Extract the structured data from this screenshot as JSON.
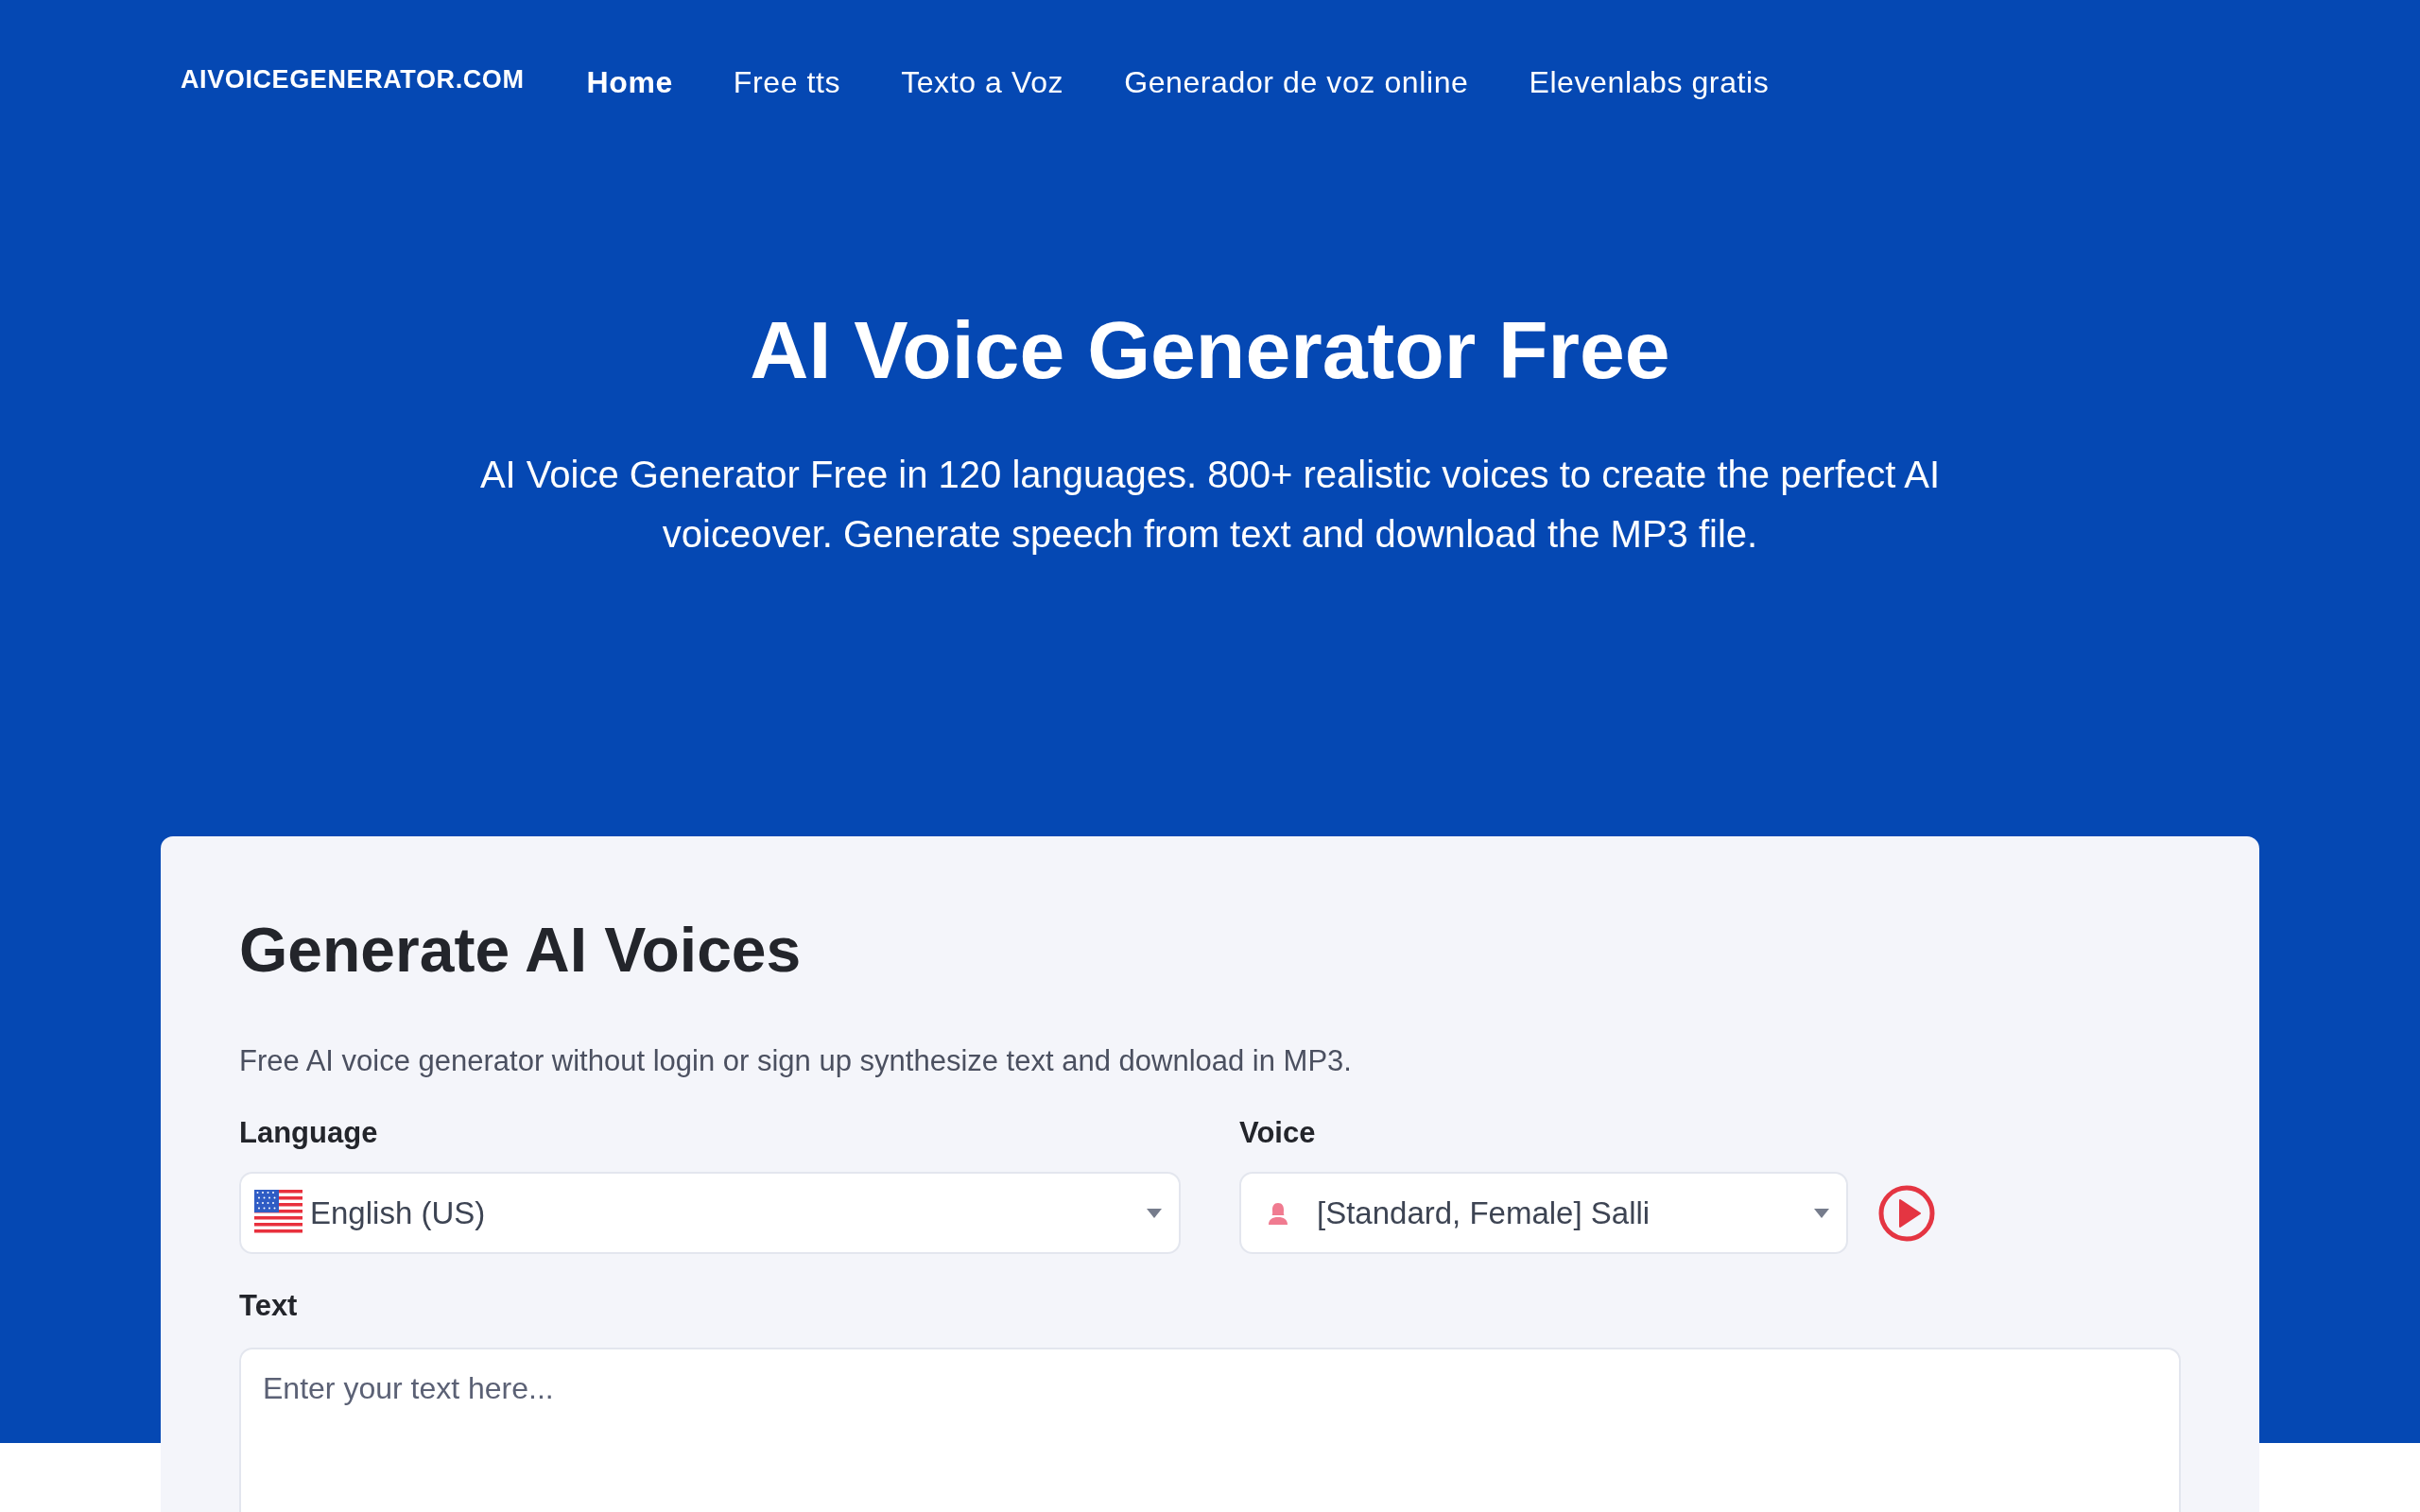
{
  "header": {
    "logo": "AIVOICEGENERATOR.COM",
    "nav": [
      {
        "label": "Home",
        "selected": true
      },
      {
        "label": "Free tts",
        "selected": false
      },
      {
        "label": "Texto a Voz",
        "selected": false
      },
      {
        "label": "Generador de voz online",
        "selected": false
      },
      {
        "label": "Elevenlabs gratis",
        "selected": false
      }
    ]
  },
  "hero": {
    "title": "AI Voice Generator Free",
    "subtitle": "AI Voice Generator Free in 120 languages. 800+ realistic voices to create the perfect AI voiceover. Generate speech from text and download the MP3 file."
  },
  "generator": {
    "title": "Generate AI Voices",
    "description": "Free AI voice generator without login or sign up synthesize text and download in MP3.",
    "language": {
      "label": "Language",
      "value": "English (US)"
    },
    "voice": {
      "label": "Voice",
      "value": "[Standard, Female] Salli"
    },
    "text": {
      "label": "Text",
      "placeholder": "Enter your text here..."
    }
  }
}
